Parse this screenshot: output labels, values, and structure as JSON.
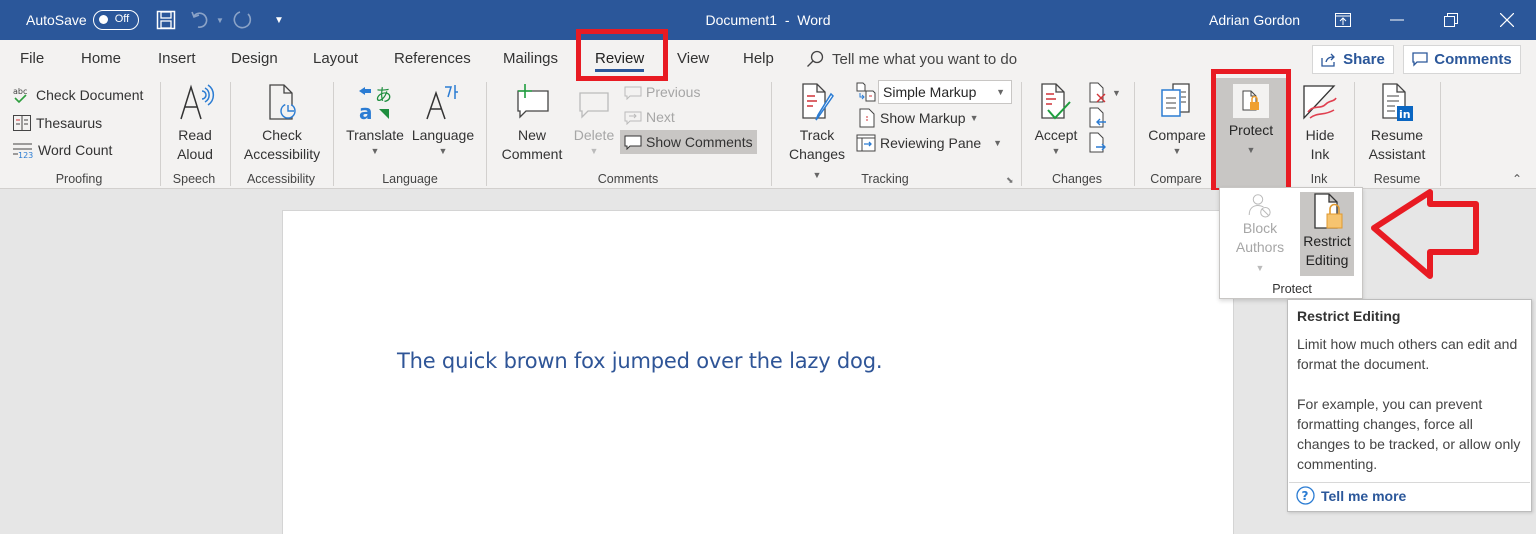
{
  "titlebar": {
    "autosave_label": "AutoSave",
    "autosave_state": "Off",
    "document_title": "Document1  -  Word",
    "user_name": "Adrian Gordon",
    "icons": [
      "save-icon",
      "undo-icon",
      "redo-icon",
      "customize-qat-icon",
      "ribbon-display-icon",
      "minimize-icon",
      "restore-icon",
      "close-icon"
    ]
  },
  "tabs": [
    {
      "label": "File"
    },
    {
      "label": "Home"
    },
    {
      "label": "Insert"
    },
    {
      "label": "Design"
    },
    {
      "label": "Layout"
    },
    {
      "label": "References"
    },
    {
      "label": "Mailings"
    },
    {
      "label": "Review",
      "active": true
    },
    {
      "label": "View"
    },
    {
      "label": "Help"
    }
  ],
  "tell_me": {
    "placeholder": "Tell me what you want to do"
  },
  "share_button": {
    "label": "Share"
  },
  "comments_button": {
    "label": "Comments"
  },
  "ribbon": {
    "proofing": {
      "label": "Proofing",
      "check_document": "Check Document",
      "thesaurus": "Thesaurus",
      "word_count": "Word Count"
    },
    "speech": {
      "label": "Speech",
      "read_aloud_1": "Read",
      "read_aloud_2": "Aloud"
    },
    "accessibility": {
      "label": "Accessibility",
      "check_1": "Check",
      "check_2": "Accessibility"
    },
    "language": {
      "label": "Language",
      "translate": "Translate",
      "language": "Language"
    },
    "comments": {
      "label": "Comments",
      "new_1": "New",
      "new_2": "Comment",
      "delete": "Delete",
      "previous": "Previous",
      "next": "Next",
      "show_comments": "Show Comments"
    },
    "tracking": {
      "label": "Tracking",
      "track_1": "Track",
      "track_2": "Changes",
      "markup_select": "Simple Markup",
      "show_markup": "Show Markup",
      "reviewing_pane": "Reviewing Pane"
    },
    "changes": {
      "label": "Changes",
      "accept": "Accept"
    },
    "compare": {
      "label": "Compare",
      "compare": "Compare"
    },
    "protect": {
      "label": "Protect"
    },
    "ink": {
      "label": "Ink",
      "hide_1": "Hide",
      "hide_2": "Ink"
    },
    "resume": {
      "label": "Resume",
      "resume_1": "Resume",
      "resume_2": "Assistant"
    }
  },
  "protect_menu": {
    "block_1": "Block",
    "block_2": "Authors",
    "restrict_1": "Restrict",
    "restrict_2": "Editing",
    "group_label": "Protect"
  },
  "tooltip": {
    "title": "Restrict Editing",
    "body_1": "Limit how much others can edit and format the document.",
    "body_2": "For example, you can prevent formatting changes, force all changes to be tracked, or allow only commenting.",
    "link": "Tell me more"
  },
  "document": {
    "text": "The quick brown fox jumped over the lazy dog."
  },
  "colors": {
    "title_bar": "#2b579a",
    "ribbon_bg": "#f3f2f1",
    "annotation_red": "#e81b23",
    "document_text": "#2f5597"
  }
}
